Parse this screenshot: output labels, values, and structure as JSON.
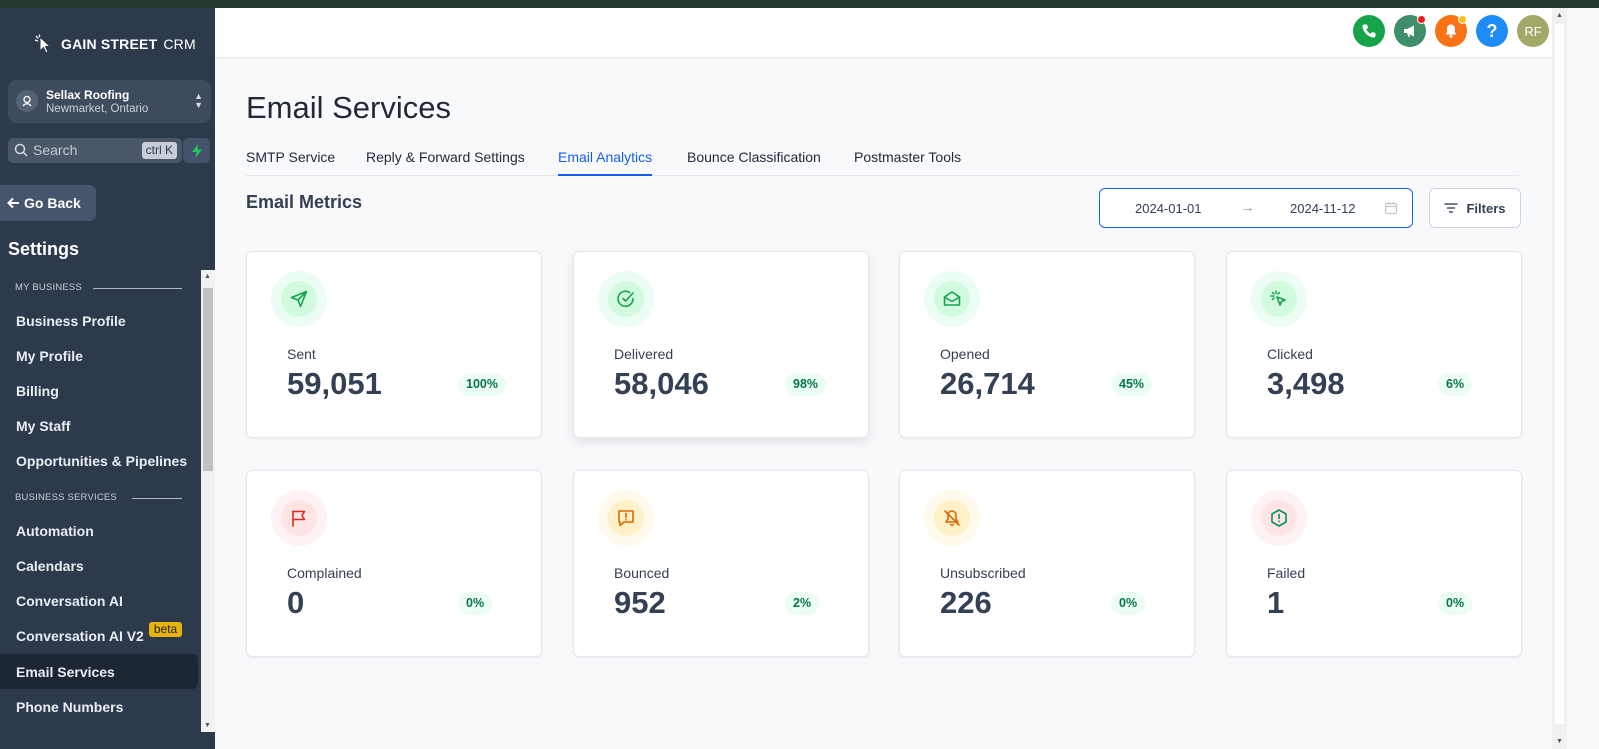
{
  "brand": {
    "name_bold": "GAIN STREET",
    "name_light": "CRM"
  },
  "location": {
    "name": "Sellax Roofing",
    "city": "Newmarket, Ontario"
  },
  "search": {
    "placeholder": "Search",
    "shortcut": "ctrl K"
  },
  "sidebar": {
    "go_back": "Go Back",
    "title": "Settings",
    "sections": [
      {
        "label": "MY BUSINESS"
      },
      {
        "label": "BUSINESS SERVICES"
      }
    ],
    "items": [
      {
        "label": "Business Profile"
      },
      {
        "label": "My Profile"
      },
      {
        "label": "Billing"
      },
      {
        "label": "My Staff"
      },
      {
        "label": "Opportunities & Pipelines"
      },
      {
        "label": "Automation"
      },
      {
        "label": "Calendars"
      },
      {
        "label": "Conversation AI"
      },
      {
        "label": "Conversation AI V2",
        "badge": "beta"
      },
      {
        "label": "Email Services",
        "active": true
      },
      {
        "label": "Phone Numbers"
      }
    ]
  },
  "header": {
    "avatar_initials": "RF",
    "colors": {
      "phone": "#16a34a",
      "megaphone": "#3f8f6a",
      "bell": "#f97316",
      "help": "#1d8cf8",
      "avatar": "#a3a86a"
    }
  },
  "page": {
    "title": "Email Services",
    "tabs": [
      {
        "label": "SMTP Service"
      },
      {
        "label": "Reply & Forward Settings"
      },
      {
        "label": "Email Analytics",
        "active": true
      },
      {
        "label": "Bounce Classification"
      },
      {
        "label": "Postmaster Tools"
      }
    ],
    "metrics_title": "Email Metrics",
    "date_start": "2024-01-01",
    "date_end": "2024-11-12",
    "filters_label": "Filters"
  },
  "metrics": [
    {
      "label": "Sent",
      "value": "59,051",
      "pct": "100%",
      "icon": "send-icon",
      "tone": "green"
    },
    {
      "label": "Delivered",
      "value": "58,046",
      "pct": "98%",
      "icon": "check-circle-icon",
      "tone": "green"
    },
    {
      "label": "Opened",
      "value": "26,714",
      "pct": "45%",
      "icon": "mail-open-icon",
      "tone": "green"
    },
    {
      "label": "Clicked",
      "value": "3,498",
      "pct": "6%",
      "icon": "click-cursor-icon",
      "tone": "green"
    },
    {
      "label": "Complained",
      "value": "0",
      "pct": "0%",
      "icon": "flag-icon",
      "tone": "red"
    },
    {
      "label": "Bounced",
      "value": "952",
      "pct": "2%",
      "icon": "message-alert-icon",
      "tone": "yellow"
    },
    {
      "label": "Unsubscribed",
      "value": "226",
      "pct": "0%",
      "icon": "bell-off-icon",
      "tone": "yellow"
    },
    {
      "label": "Failed",
      "value": "1",
      "pct": "0%",
      "icon": "alert-hexagon-icon",
      "tone": "red"
    }
  ]
}
